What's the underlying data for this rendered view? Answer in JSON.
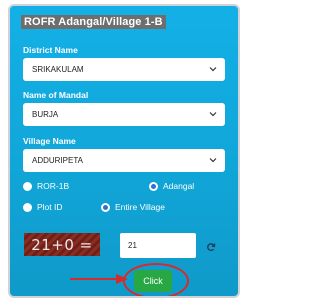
{
  "form": {
    "title": "ROFR Adangal/Village 1-B",
    "district": {
      "label": "District Name",
      "value": "SRIKAKULAM"
    },
    "mandal": {
      "label": "Name of Mandal",
      "value": "BURJA"
    },
    "village": {
      "label": "Village Name",
      "value": "ADDURIPETA"
    },
    "options": [
      {
        "label": "ROR-1B",
        "checked": false
      },
      {
        "label": "Adangal",
        "checked": true
      },
      {
        "label": "Plot ID",
        "checked": false
      },
      {
        "label": "Entire Village",
        "checked": true
      }
    ],
    "captcha": {
      "text": "21+0 =",
      "answer": "21"
    },
    "submit_label": "Click"
  },
  "colors": {
    "panel": "#11a6d8",
    "title_bg": "#6e6e6e",
    "button": "#28a745",
    "annotation": "#d62b2b",
    "captcha_bg": "#8a2d22"
  },
  "icons": [
    "chevron-down-icon",
    "refresh-icon",
    "arrow-right-icon"
  ]
}
